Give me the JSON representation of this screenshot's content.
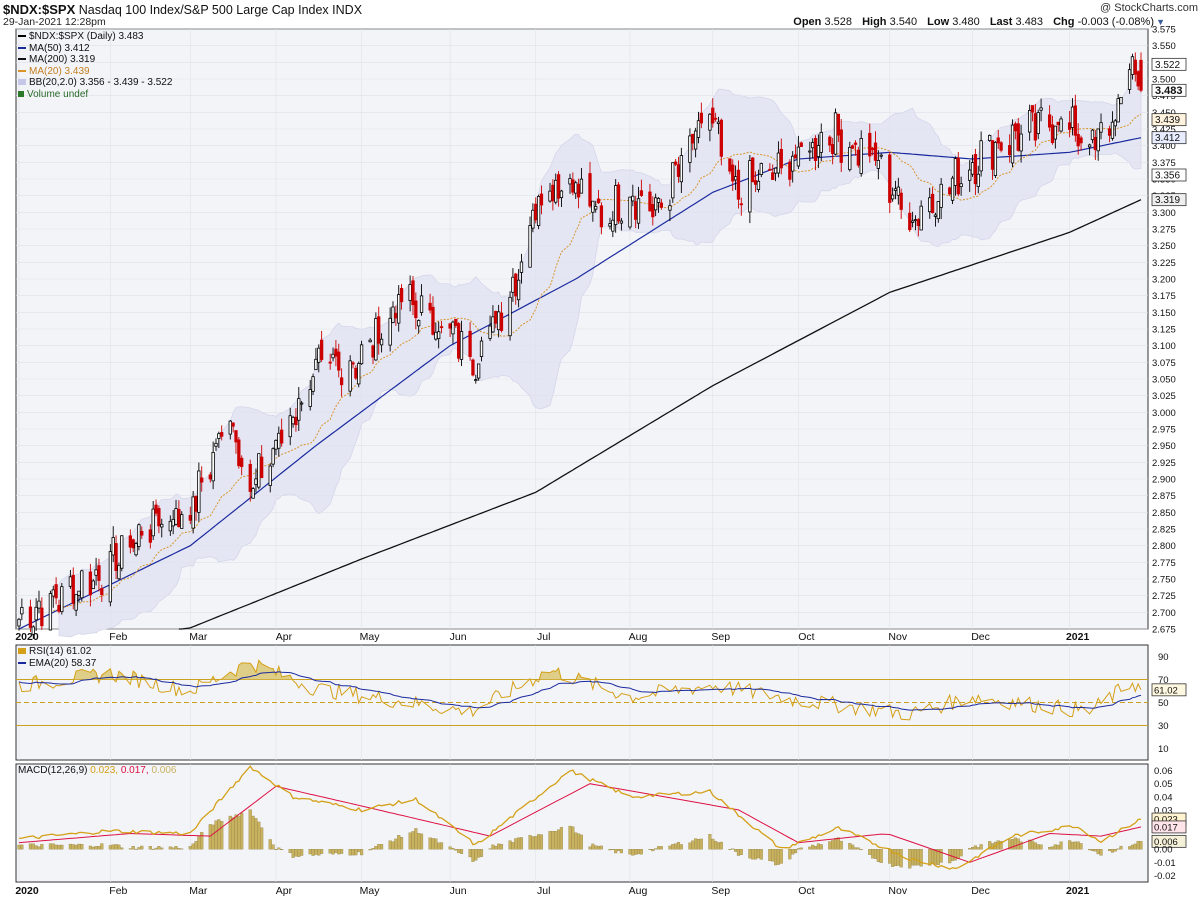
{
  "header": {
    "symbol": "$NDX:$SPX",
    "description": "Nasdaq 100 Index/S&P 500 Large Cap Index",
    "exchange": "INDX",
    "date_time": "29-Jan-2021 12:28pm",
    "brand": "@ StockCharts.com",
    "open_label": "Open",
    "open": "3.528",
    "high_label": "High",
    "high": "3.540",
    "low_label": "Low",
    "low": "3.480",
    "last_label": "Last",
    "last": "3.483",
    "chg_label": "Chg",
    "chg": "-0.003 (-0.08%)"
  },
  "price_legend": {
    "main": "$NDX:$SPX (Daily) 3.483",
    "ma50": "MA(50) 3.412",
    "ma200": "MA(200) 3.319",
    "ma20": "MA(20) 3.439",
    "bb": "BB(20,2.0) 3.356 - 3.439 - 3.522",
    "volume": "Volume undef"
  },
  "rsi_legend": {
    "rsi": "RSI(14) 61.02",
    "ema": "EMA(20) 58.37"
  },
  "macd_legend": {
    "label": "MACD(12,26,9)",
    "macd": "0.023,",
    "signal": "0.017,",
    "hist": "0.006"
  },
  "price_axis_labels": [
    "3.575",
    "3.550",
    "3.525",
    "3.500",
    "3.475",
    "3.450",
    "3.425",
    "3.400",
    "3.375",
    "3.350",
    "3.325",
    "3.300",
    "3.275",
    "3.250",
    "3.225",
    "3.200",
    "3.175",
    "3.150",
    "3.125",
    "3.100",
    "3.075",
    "3.050",
    "3.025",
    "3.000",
    "2.975",
    "2.950",
    "2.925",
    "2.900",
    "2.875",
    "2.850",
    "2.825",
    "2.800",
    "2.775",
    "2.750",
    "2.725",
    "2.700",
    "2.675"
  ],
  "price_value_tags": [
    {
      "label": "3.522",
      "bold": false,
      "fill": "#ffffff"
    },
    {
      "label": "3.483",
      "bold": true,
      "fill": "#ffffff"
    },
    {
      "label": "3.439",
      "bold": false,
      "fill": "#fff3dd"
    },
    {
      "label": "3.412",
      "bold": false,
      "fill": "#e8ecff"
    },
    {
      "label": "3.356",
      "bold": false,
      "fill": "#ffffff"
    },
    {
      "label": "3.319",
      "bold": false,
      "fill": "#eeeeee"
    }
  ],
  "rsi_axis_labels": [
    "90",
    "70",
    "61.02",
    "50",
    "30",
    "10"
  ],
  "macd_axis_labels": [
    "0.06",
    "0.05",
    "0.04",
    "0.03",
    "0.023",
    "0.017",
    "0.006",
    "0.00",
    "-0.01",
    "-0.02"
  ],
  "month_labels": [
    "2020",
    "Feb",
    "Mar",
    "Apr",
    "May",
    "Jun",
    "Jul",
    "Aug",
    "Sep",
    "Oct",
    "Nov",
    "Dec",
    "2021"
  ],
  "colors": {
    "panel_bg": "#f3f4f8",
    "up_candle": "#000000",
    "down_candle": "#cc0000",
    "ma50": "#1a2a9e",
    "ma200": "#111111",
    "ma20": "#d9952a",
    "bb_fill": "#e4e6f4",
    "rsi": "#d4a017",
    "rsi_ema": "#1a2a9e",
    "macd": "#d4a017",
    "signal": "#dd1144",
    "hist": "#c8b260"
  },
  "chart_data": {
    "type": "candlestick",
    "title": "$NDX:$SPX (Daily)",
    "period": "2020-01-02 to 2021-01-29",
    "ylim": [
      2.675,
      3.575
    ],
    "grid": true,
    "x_ticks": [
      "2020",
      "Feb",
      "Mar",
      "Apr",
      "May",
      "Jun",
      "Jul",
      "Aug",
      "Sep",
      "Oct",
      "Nov",
      "Dec",
      "2021"
    ],
    "close_anchors": [
      [
        "2020-01-02",
        2.69
      ],
      [
        "2020-01-31",
        2.76
      ],
      [
        "2020-02-19",
        2.84
      ],
      [
        "2020-03-02",
        2.85
      ],
      [
        "2020-03-16",
        3.0
      ],
      [
        "2020-03-23",
        2.88
      ],
      [
        "2020-04-01",
        2.95
      ],
      [
        "2020-04-15",
        3.06
      ],
      [
        "2020-05-01",
        3.08
      ],
      [
        "2020-05-15",
        3.17
      ],
      [
        "2020-06-01",
        3.12
      ],
      [
        "2020-06-10",
        3.08
      ],
      [
        "2020-06-24",
        3.2
      ],
      [
        "2020-07-02",
        3.33
      ],
      [
        "2020-07-13",
        3.35
      ],
      [
        "2020-07-24",
        3.29
      ],
      [
        "2020-08-03",
        3.33
      ],
      [
        "2020-08-12",
        3.3
      ],
      [
        "2020-08-31",
        3.45
      ],
      [
        "2020-09-08",
        3.33
      ],
      [
        "2020-09-23",
        3.36
      ],
      [
        "2020-10-12",
        3.42
      ],
      [
        "2020-10-28",
        3.38
      ],
      [
        "2020-11-09",
        3.29
      ],
      [
        "2020-11-20",
        3.33
      ],
      [
        "2020-12-08",
        3.4
      ],
      [
        "2020-12-31",
        3.44
      ],
      [
        "2021-01-13",
        3.4
      ],
      [
        "2021-01-22",
        3.46
      ],
      [
        "2021-01-26",
        3.53
      ],
      [
        "2021-01-29",
        3.483
      ]
    ],
    "series": [
      {
        "name": "MA(50)",
        "last": 3.412,
        "anchors": [
          [
            "2020-01-02",
            2.675
          ],
          [
            "2020-03-02",
            2.8
          ],
          [
            "2020-04-15",
            2.95
          ],
          [
            "2020-06-01",
            3.1
          ],
          [
            "2020-07-15",
            3.2
          ],
          [
            "2020-09-01",
            3.33
          ],
          [
            "2020-10-01",
            3.38
          ],
          [
            "2020-11-02",
            3.39
          ],
          [
            "2020-12-01",
            3.38
          ],
          [
            "2021-01-04",
            3.39
          ],
          [
            "2021-01-29",
            3.412
          ]
        ]
      },
      {
        "name": "MA(200)",
        "last": 3.319,
        "anchors": [
          [
            "2020-03-01",
            2.675
          ],
          [
            "2020-05-01",
            2.78
          ],
          [
            "2020-07-01",
            2.88
          ],
          [
            "2020-09-01",
            3.04
          ],
          [
            "2020-11-02",
            3.18
          ],
          [
            "2021-01-04",
            3.27
          ],
          [
            "2021-01-29",
            3.319
          ]
        ]
      },
      {
        "name": "MA(20)",
        "last": 3.439
      },
      {
        "name": "BB(20,2.0)",
        "lower": 3.356,
        "middle": 3.439,
        "upper": 3.522
      }
    ],
    "rsi": {
      "name": "RSI(14)",
      "last": 61.02,
      "ema_name": "EMA(20)",
      "ema_last": 58.37,
      "ylim": [
        0,
        100
      ],
      "levels": [
        70,
        50,
        30
      ],
      "anchors": [
        [
          "2020-01-02",
          65
        ],
        [
          "2020-02-03",
          75
        ],
        [
          "2020-03-02",
          60
        ],
        [
          "2020-03-23",
          85
        ],
        [
          "2020-04-15",
          62
        ],
        [
          "2020-06-08",
          42
        ],
        [
          "2020-07-06",
          78
        ],
        [
          "2020-08-03",
          55
        ],
        [
          "2020-09-01",
          65
        ],
        [
          "2020-10-01",
          52
        ],
        [
          "2020-11-09",
          40
        ],
        [
          "2020-12-01",
          55
        ],
        [
          "2021-01-11",
          42
        ],
        [
          "2021-01-26",
          68
        ],
        [
          "2021-01-29",
          61.02
        ]
      ]
    },
    "macd": {
      "name": "MACD(12,26,9)",
      "macd_last": 0.023,
      "signal_last": 0.017,
      "hist_last": 0.006,
      "ylim": [
        -0.025,
        0.065
      ],
      "macd_anchors": [
        [
          "2020-01-02",
          0.008
        ],
        [
          "2020-02-03",
          0.014
        ],
        [
          "2020-03-02",
          0.012
        ],
        [
          "2020-03-23",
          0.063
        ],
        [
          "2020-04-07",
          0.04
        ],
        [
          "2020-05-01",
          0.03
        ],
        [
          "2020-05-20",
          0.038
        ],
        [
          "2020-06-10",
          0.003
        ],
        [
          "2020-07-13",
          0.06
        ],
        [
          "2020-08-03",
          0.04
        ],
        [
          "2020-08-31",
          0.044
        ],
        [
          "2020-09-25",
          0.0
        ],
        [
          "2020-10-15",
          0.016
        ],
        [
          "2020-11-10",
          -0.008
        ],
        [
          "2020-11-25",
          -0.015
        ],
        [
          "2020-12-15",
          0.01
        ],
        [
          "2021-01-06",
          0.018
        ],
        [
          "2021-01-15",
          0.006
        ],
        [
          "2021-01-29",
          0.023
        ]
      ],
      "signal_anchors": [
        [
          "2020-01-02",
          0.005
        ],
        [
          "2020-02-10",
          0.012
        ],
        [
          "2020-03-09",
          0.01
        ],
        [
          "2020-04-01",
          0.048
        ],
        [
          "2020-05-01",
          0.033
        ],
        [
          "2020-06-15",
          0.01
        ],
        [
          "2020-07-20",
          0.05
        ],
        [
          "2020-08-15",
          0.04
        ],
        [
          "2020-09-10",
          0.03
        ],
        [
          "2020-10-01",
          0.005
        ],
        [
          "2020-11-01",
          0.012
        ],
        [
          "2020-11-30",
          -0.01
        ],
        [
          "2020-12-28",
          0.012
        ],
        [
          "2021-01-15",
          0.01
        ],
        [
          "2021-01-29",
          0.017
        ]
      ]
    }
  }
}
